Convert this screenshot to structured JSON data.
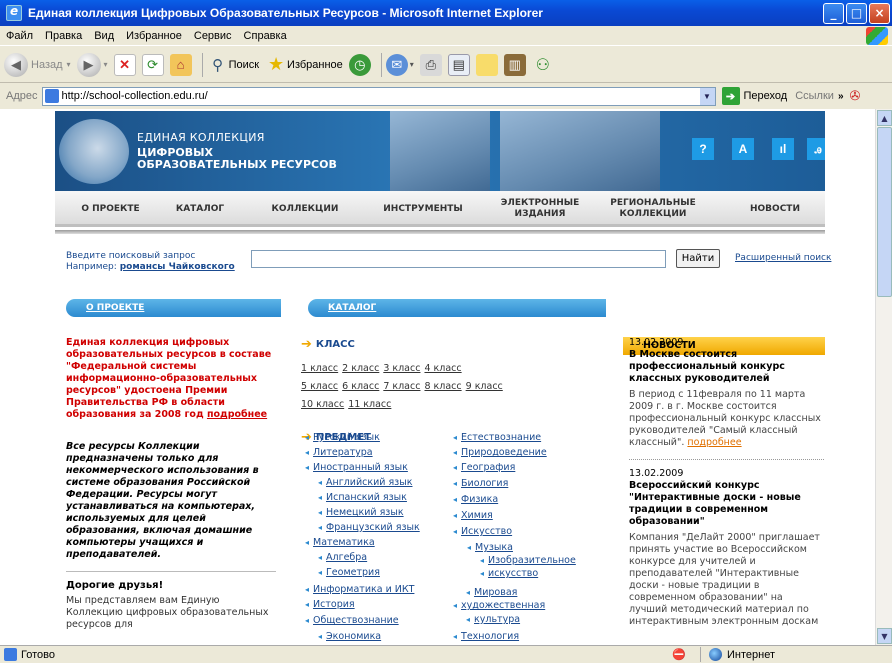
{
  "window": {
    "title": "Единая коллекция Цифровых Образовательных Ресурсов - Microsoft Internet Explorer"
  },
  "menu": [
    "Файл",
    "Правка",
    "Вид",
    "Избранное",
    "Сервис",
    "Справка"
  ],
  "toolbar": {
    "back": "Назад",
    "search": "Поиск",
    "favorites": "Избранное"
  },
  "address": {
    "label": "Адрес",
    "url": "http://school-collection.edu.ru/",
    "go": "Переход",
    "links": "Ссылки"
  },
  "site": {
    "title_line1": "ЕДИНАЯ КОЛЛЕКЦИЯ",
    "title_line2": "ЦИФРОВЫХ",
    "title_line3": "ОБРАЗОВАТЕЛЬНЫХ РЕСУРСОВ",
    "header_buttons": [
      "?",
      "A",
      "ıl",
      "ꭿ"
    ]
  },
  "nav": [
    "О ПРОЕКТЕ",
    "КАТАЛОГ",
    "КОЛЛЕКЦИИ",
    "ИНСТРУМЕНТЫ",
    "ЭЛЕКТРОННЫЕ ИЗДАНИЯ",
    "РЕГИОНАЛЬНЫЕ КОЛЛЕКЦИИ",
    "НОВОСТИ"
  ],
  "search": {
    "hint": "Введите поисковый запрос",
    "example_label": "Например:",
    "example_link": "романсы Чайковского",
    "button": "Найти",
    "advanced": "Расширенный поиск",
    "value": ""
  },
  "sections": {
    "about": "О ПРОЕКТЕ",
    "catalog": "КАТАЛОГ",
    "news": "НОВОСТИ"
  },
  "about": {
    "red_text": "Единая коллекция цифровых образовательных ресурсов в составе \"Федеральной системы информационно-образовательных ресурсов\" удостоена Премии Правительства РФ в области образования за 2008 год",
    "more": "подробнее",
    "italic_text": "Все ресурсы Коллекции предназначены только для некоммерческого использования в системе образования Российской Федерации. Ресурсы могут устанавливаться на компьютерах, используемых для целей образования, включая домашние компьютеры учащихся и преподавателей.",
    "friends_title": "Дорогие друзья!",
    "friends_text": "Мы представляем вам Единую Коллекцию цифровых образовательных ресурсов для"
  },
  "catalog": {
    "class_header": "КЛАСС",
    "classes_row1": [
      "1 класс",
      "2 класс",
      "3 класс",
      "4 класс"
    ],
    "classes_row2": [
      "5 класс",
      "6 класс",
      "7 класс",
      "8 класс",
      "9 класс"
    ],
    "classes_row3": [
      "10 класс",
      "11 класс"
    ],
    "subject_header": "ПРЕДМЕТ",
    "subjects_left": [
      "Русский язык",
      "Литература",
      "Иностранный язык",
      "Английский язык",
      "Испанский язык",
      "Немецкий язык",
      "Французский язык",
      "Математика",
      "Алгебра",
      "Геометрия",
      "Информатика и ИКТ",
      "История",
      "Обществознание",
      "Экономика"
    ],
    "subjects_right": [
      "Естествознание",
      "Природоведение",
      "География",
      "Биология",
      "Физика",
      "Химия",
      "Искусство",
      "Музыка",
      "Изобразительное",
      "искусство",
      "Мировая",
      "художественная",
      "культура",
      "Технология"
    ]
  },
  "news": [
    {
      "date": "13.02.2009",
      "title": "В Москве состоится профессиональный конкурс классных руководителей",
      "body": "В период с 11февраля по 11 марта 2009 г. в г. Москве состоится профессиональный конкурс классных руководителей \"Самый классный классный\".",
      "more": "подробнее"
    },
    {
      "date": "13.02.2009",
      "title": "Всероссийский конкурс \"Интерактивные доски - новые традиции в современном образовании\"",
      "body": "Компания \"ДеЛайт 2000\" приглашает принять участие во Всероссийском конкурсе для учителей и преподавателей \"Интерактивные доски - новые традиции в современном образовании\" на лучший методический материал по интерактивным электронным доскам"
    }
  ],
  "status": {
    "left": "Готово",
    "zone": "Интернет"
  }
}
